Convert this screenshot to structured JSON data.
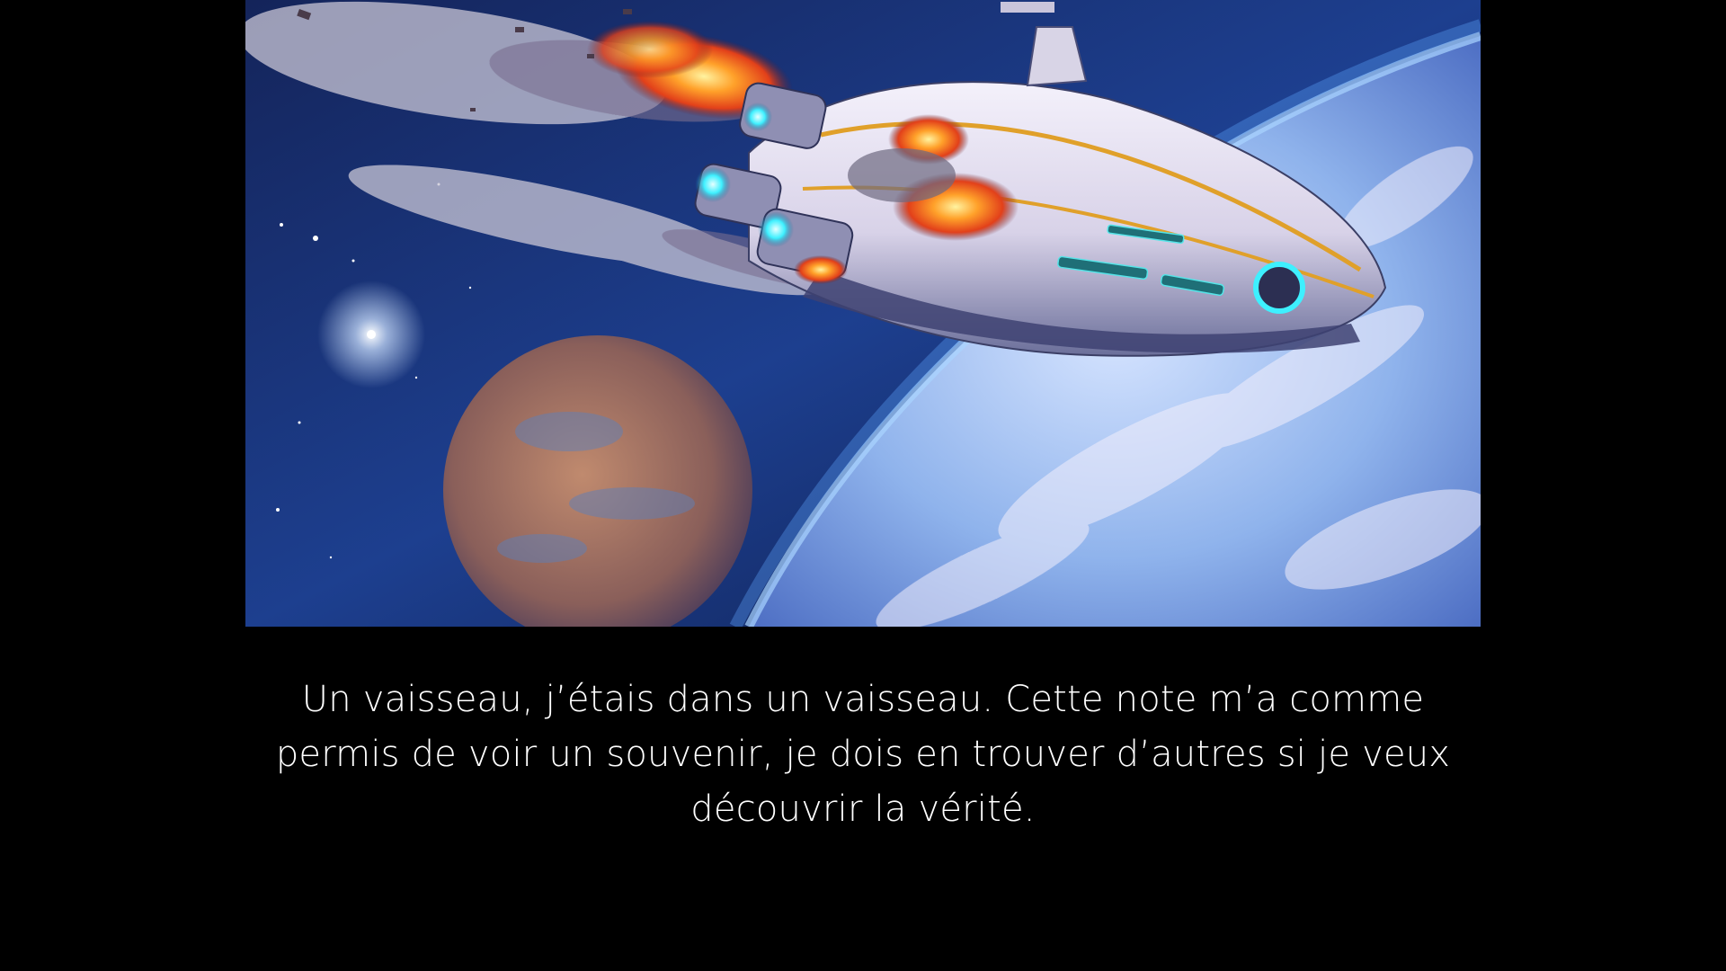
{
  "cutscene": {
    "image_subject": "burning-spaceship-over-planet",
    "caption": "Un vaisseau, j’étais dans un vaisseau. Cette note m’a comme permis de voir un souvenir, je dois en trouver d’autres si je veux découvrir la vérité."
  },
  "colors": {
    "background": "#000000",
    "text": "#ffffff",
    "space": "#0b1d4a",
    "planet_glow": "#7fb6ff",
    "fire": "#ff6a1a",
    "hull": "#e9e6f2",
    "stripe": "#e0a02a",
    "engine_glow": "#3ef0ff"
  }
}
